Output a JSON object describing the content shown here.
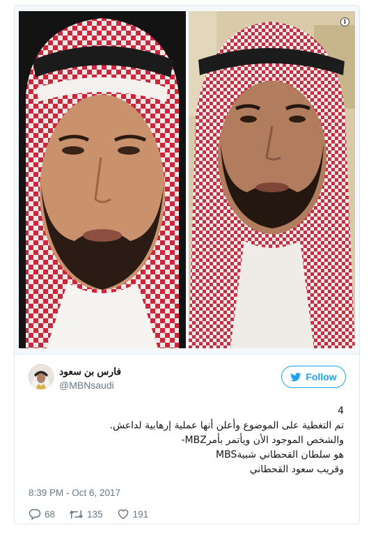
{
  "tweet": {
    "author": {
      "display_name": "فارس بن سعود",
      "handle": "@MBNsaudi"
    },
    "follow_label": "Follow",
    "text_lines": [
      "4",
      "تم التغطية على الموضوع وأعلن أنها عملية إرهابية لداعش.",
      "والشخص الموجود الأن ويأتمر بأمرMBZ-",
      "هو سلطان القحطاني شبيةMBS",
      "وقريب سعود القحطاني"
    ],
    "timestamp": "8:39 PM - Oct 6, 2017",
    "stats": {
      "replies": "68",
      "retweets": "135",
      "likes": "191"
    },
    "media": {
      "info_icon": "i",
      "icons": [
        "info-icon"
      ]
    }
  },
  "colors": {
    "brand": "#1da1f2",
    "muted": "#657786",
    "border": "#e1e8ed",
    "text": "#14171a"
  },
  "icons": [
    "twitter-bird-icon",
    "reply-icon",
    "retweet-icon",
    "like-icon"
  ]
}
